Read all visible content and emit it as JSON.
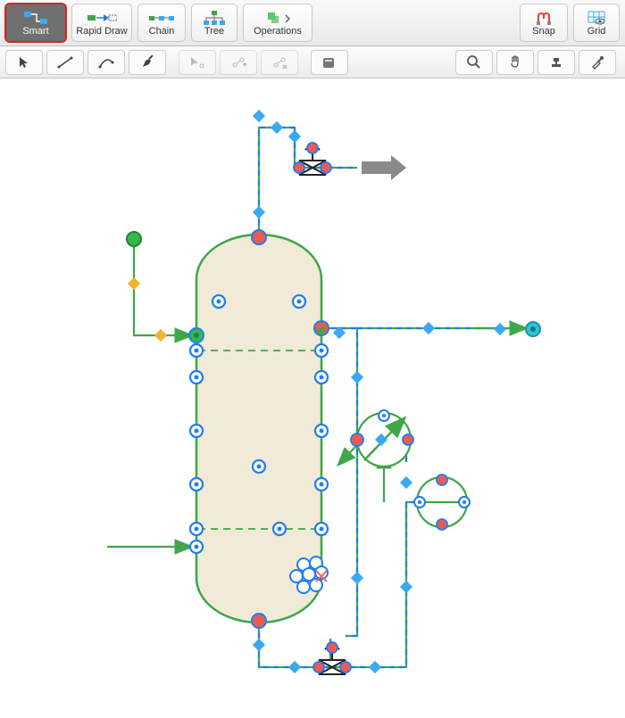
{
  "toolbar": {
    "smart": "Smart",
    "rapid": "Rapid Draw",
    "chain": "Chain",
    "tree": "Tree",
    "operations": "Operations",
    "snap": "Snap",
    "grid": "Grid"
  },
  "iconNames": {
    "smart": "smart-connector-icon",
    "rapid": "rapid-draw-icon",
    "chain": "chain-icon",
    "tree": "tree-icon",
    "operations": "operations-icon",
    "snap": "snap-icon",
    "grid": "grid-icon"
  },
  "subtools": [
    "pointer-icon",
    "line-icon",
    "curve-icon",
    "pen-icon",
    "edit-point-icon",
    "add-point-icon",
    "remove-point-icon",
    "clipboard-icon",
    "zoom-icon",
    "pan-icon",
    "stamp-icon",
    "eyedropper-icon"
  ],
  "colors": {
    "vesselStroke": "#3fa649",
    "vesselFill": "#f0ead6",
    "pipeDash": "#1f7df1",
    "pipeGap": "#3fa649",
    "diamond": "#3ba9f2",
    "portRing": "#1f7df1",
    "portRed": "#ee5a52",
    "portGreen": "#3fa649",
    "portOrange": "#f1b42b",
    "arrowGray": "#8a8a8a",
    "cyan": "#2fc0d6"
  }
}
